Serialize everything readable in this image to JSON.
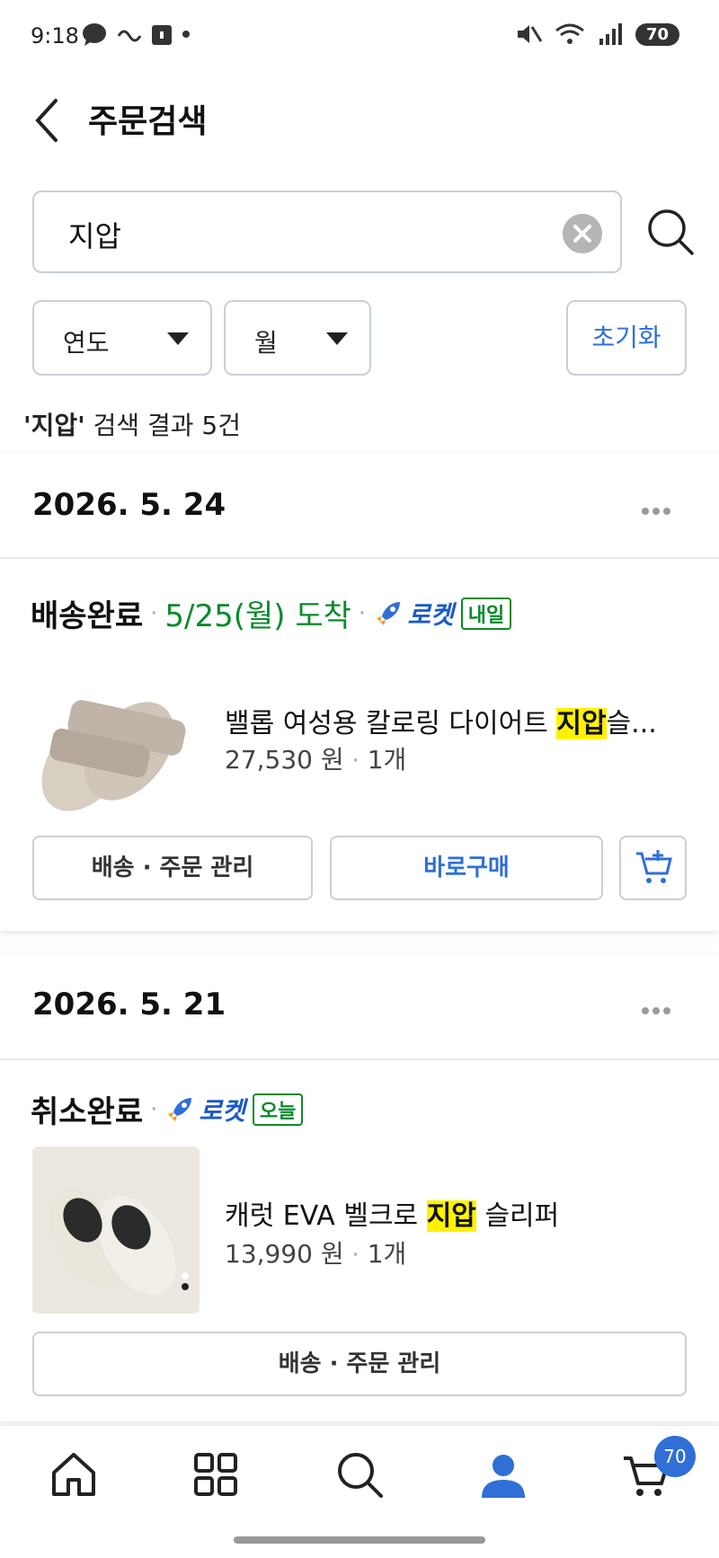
{
  "status_bar": {
    "time": "9:18",
    "battery": "70"
  },
  "header": {
    "title": "주문검색"
  },
  "search": {
    "value": "지압"
  },
  "filters": {
    "year_label": "연도",
    "month_label": "월",
    "reset_label": "초기화"
  },
  "result": {
    "keyword": "'지압'",
    "summary": "검색 결과 5건"
  },
  "orders": [
    {
      "date": "2026. 5. 24",
      "status": "배송완료",
      "arrival": "5/25(월) 도착",
      "rocket_label": "로켓",
      "rocket_badge": "내일",
      "product_prefix": "밸롭 여성용 칼로링 다이어트 ",
      "product_highlight": "지압",
      "product_suffix": "슬...",
      "price": "27,530 원",
      "qty": "1개",
      "manage_label": "배송 · 주문 관리",
      "buy_label": "바로구매"
    },
    {
      "date": "2026. 5. 21",
      "status": "취소완료",
      "rocket_label": "로켓",
      "rocket_badge": "오늘",
      "product_prefix": "캐럿 EVA 벨크로 ",
      "product_highlight": "지압",
      "product_suffix": " 슬리퍼",
      "price": "13,990 원",
      "qty": "1개",
      "manage_label": "배송 · 주문 관리"
    }
  ],
  "bottom_nav": {
    "cart_count": "70"
  },
  "colors": {
    "accent": "#2f6fd6",
    "arrival_green": "#0b8a2b",
    "highlight": "#fff200"
  }
}
